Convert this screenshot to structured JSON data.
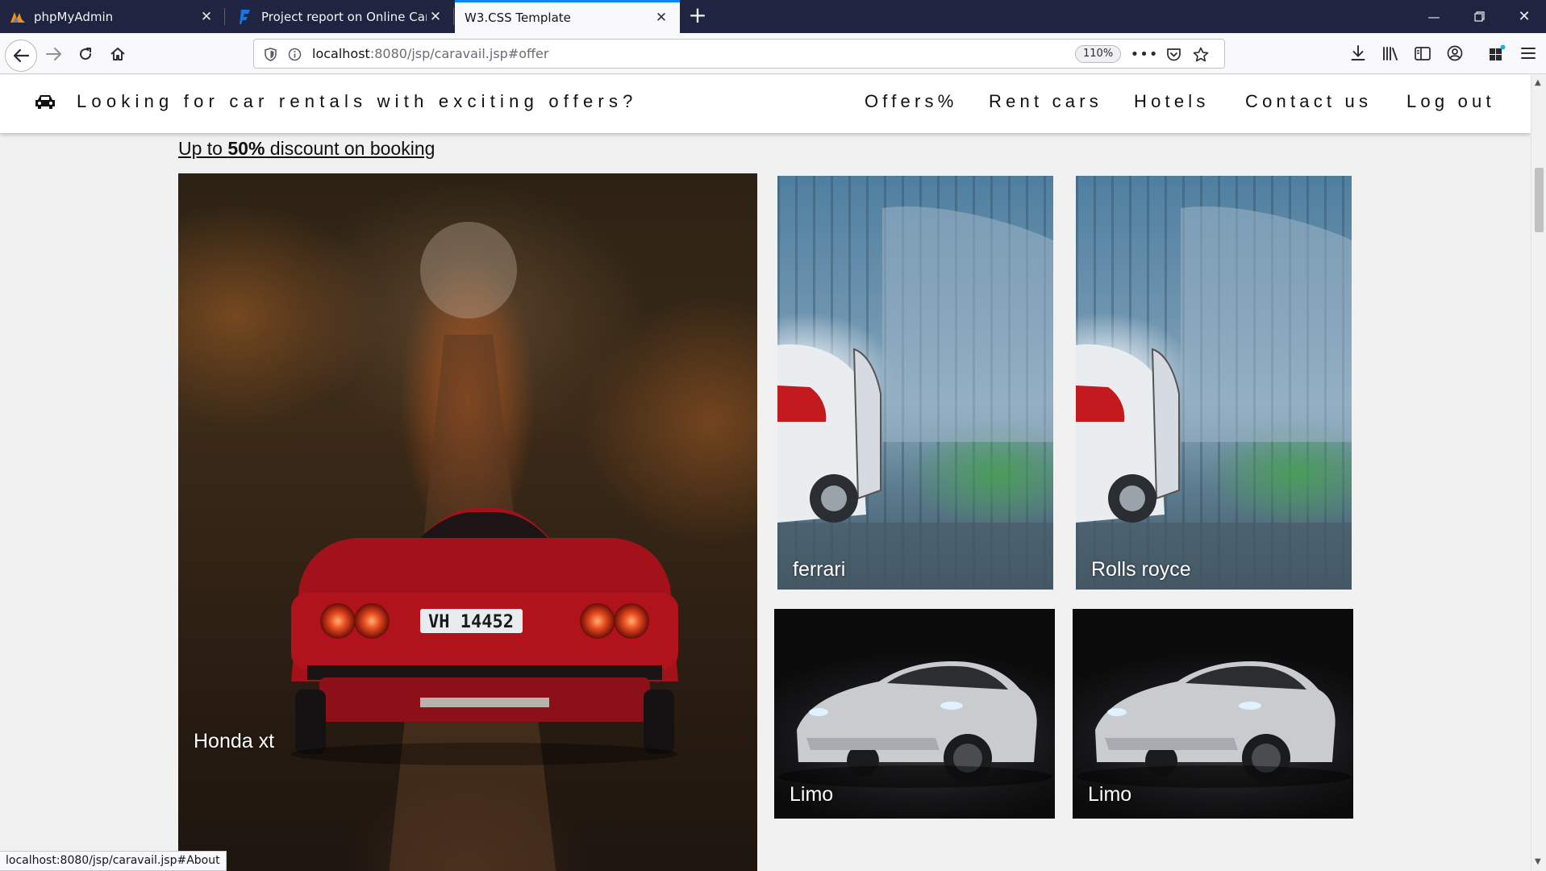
{
  "browser": {
    "tabs": [
      {
        "title": "phpMyAdmin",
        "icon": "phpmyadmin-icon"
      },
      {
        "title": "Project report on Online Car Re",
        "icon": "freepdf-icon"
      },
      {
        "title": "W3.CSS Template",
        "icon": "none"
      }
    ],
    "url_host": "localhost",
    "url_rest": ":8080/jsp/caravail.jsp#offer",
    "zoom": "110%",
    "status_url": "localhost:8080/jsp/caravail.jsp#About"
  },
  "site": {
    "brand_text": "Looking for car rentals with exciting offers?",
    "nav": [
      "Offers%",
      "Rent cars",
      "Hotels",
      "Contact us",
      "Log out"
    ],
    "discount_pre": "Up to ",
    "discount_bold": "50%",
    "discount_post": " discount on booking",
    "cards": [
      {
        "caption": "Honda xt"
      },
      {
        "caption": "ferrari"
      },
      {
        "caption": "Rolls royce"
      },
      {
        "caption": "Limo"
      },
      {
        "caption": "Limo"
      }
    ]
  },
  "colors": {
    "tab_strip": "#1f2440",
    "active_tab_accent": "#0a84ff",
    "page_background": "#f1f1f1"
  }
}
